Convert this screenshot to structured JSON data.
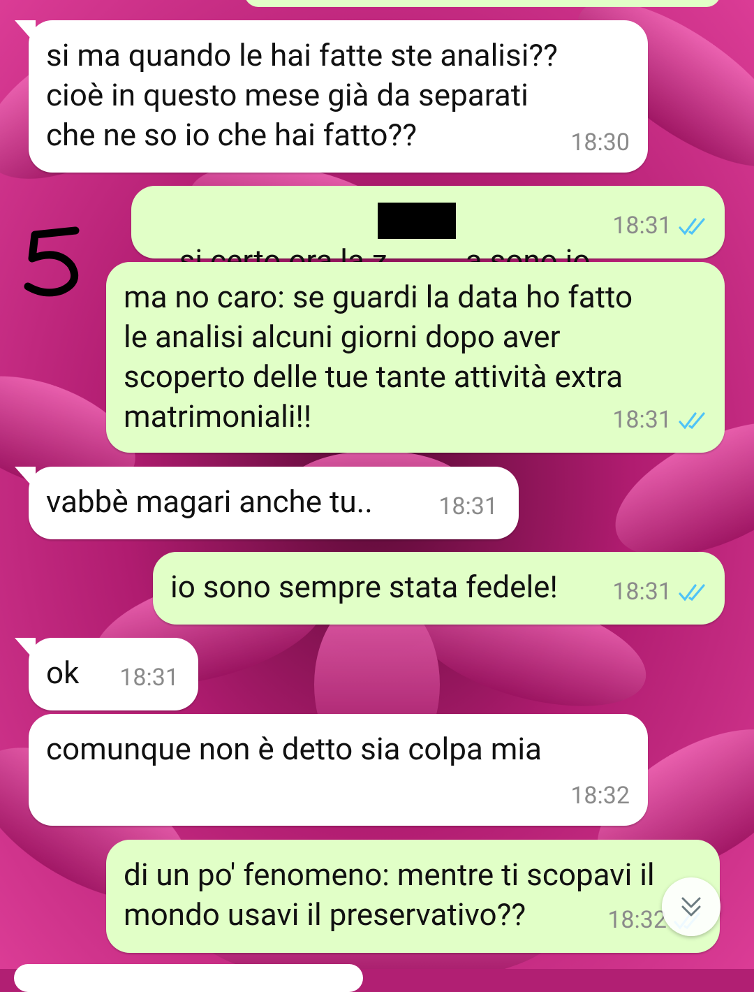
{
  "messages": [
    {
      "id": "m1",
      "dir": "in",
      "text": "si ma quando le hai fatte ste analisi??\ncioè in questo mese già da separati\nche ne so io che hai fatto??",
      "time": "18:30"
    },
    {
      "id": "m2",
      "dir": "out",
      "text_pre": "si certo ora la z",
      "text_post": "a sono io",
      "time": "18:31",
      "ticks": "read"
    },
    {
      "id": "m3",
      "dir": "out",
      "text": "ma no caro: se guardi la data ho fatto\nle analisi alcuni giorni dopo aver\nscoperto delle tue tante attività extra\nmatrimoniali!!",
      "time": "18:31",
      "ticks": "read"
    },
    {
      "id": "m4",
      "dir": "in",
      "text": "vabbè magari anche tu..",
      "time": "18:31"
    },
    {
      "id": "m5",
      "dir": "out",
      "text": "io sono sempre stata fedele!",
      "time": "18:31",
      "ticks": "read"
    },
    {
      "id": "m6",
      "dir": "in",
      "text": "ok",
      "time": "18:31"
    },
    {
      "id": "m7",
      "dir": "in",
      "text": "comunque non è detto sia colpa mia",
      "time": "18:32"
    },
    {
      "id": "m8",
      "dir": "out",
      "text": "di un po' fenomeno: mentre ti scopavi il\nmondo usavi il preservativo??",
      "time": "18:32",
      "ticks": "read"
    }
  ],
  "annotation": {
    "marker_label": "5"
  },
  "icons": {
    "read_ticks": "double-check-icon",
    "scroll_down": "chevron-double-down-icon"
  },
  "colors": {
    "incoming": "#ffffff",
    "outgoing": "#e1ffc7",
    "read_tick": "#4fc3f7",
    "time": "#8a8a8a"
  }
}
